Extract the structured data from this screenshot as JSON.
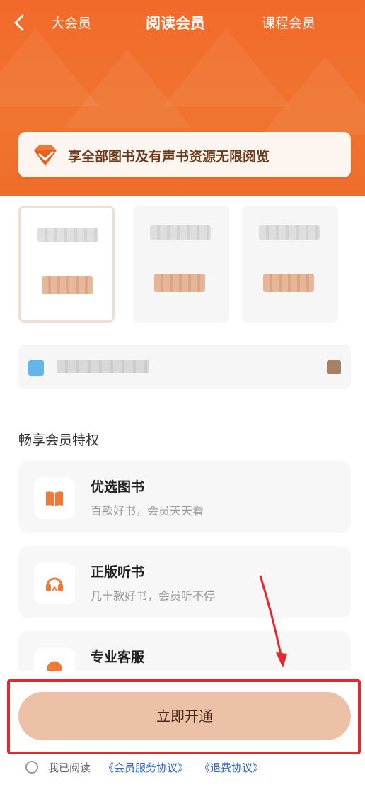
{
  "nav": {
    "back_icon": "chevron-left-icon",
    "tabs": [
      {
        "label": "大会员"
      },
      {
        "label": "阅读会员"
      },
      {
        "label": "课程会员"
      }
    ],
    "active_tab": "阅读会员"
  },
  "banner": {
    "icon": "diamond-icon",
    "text": "享全部图书及有声书资源无限阅览"
  },
  "plans": {
    "count": 3,
    "selected_index": 0
  },
  "benefits_section": {
    "title": "畅享会员特权",
    "items": [
      {
        "icon": "book-icon",
        "title": "优选图书",
        "subtitle": "百款好书，会员天天看"
      },
      {
        "icon": "headphones-icon",
        "title": "正版听书",
        "subtitle": "几十款好书，会员听不停"
      },
      {
        "icon": "headset-icon",
        "title": "专业客服",
        "subtitle": ""
      }
    ]
  },
  "cta": {
    "label": "立即开通"
  },
  "agreement": {
    "prefix": "我已阅读",
    "link1": "《会员服务协议》",
    "link2": "《退费协议》"
  },
  "colors": {
    "header_orange": "#f26a2a",
    "cta_bg": "#edc1a8",
    "link_blue": "#2f64c8",
    "annotation_red": "#e8262c"
  }
}
